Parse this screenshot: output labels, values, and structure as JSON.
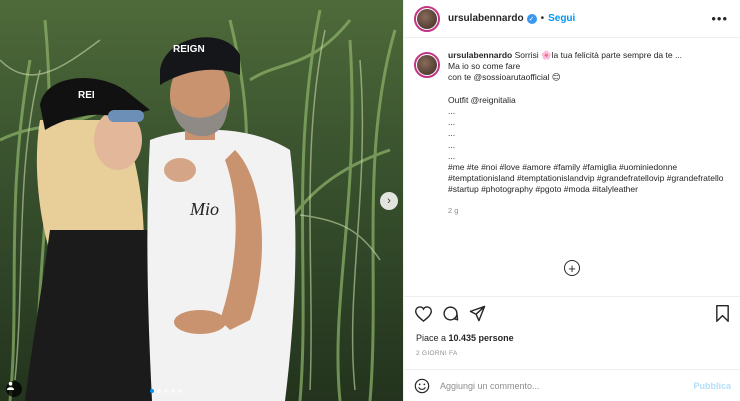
{
  "post": {
    "username": "ursulabennardo",
    "follow_label": "Segui",
    "separator": "•",
    "more_label": "•••",
    "caption_lines": [
      "Sorrisi 🌸la tua felicità parte sempre da te ...",
      "Ma io so come fare",
      "con te @sossioarutaofficial 😊",
      "",
      "Outfit @reignitalia",
      "...",
      "...",
      "...",
      "...",
      "..."
    ],
    "hashtags": "#me #te #noi #love #amore #family #famiglia #uominiedonne #temptationisland #temptationislandvip #grandefratellovip #grandefratello #startup #photography #pgoto #moda #italyleather",
    "comment_age": "2 g",
    "likes_prefix": "Piace a ",
    "likes_count": "10.435 persone",
    "date": "2 GIORNI FA",
    "comment_placeholder": "Aggiungi un commento...",
    "publish_label": "Pubblica",
    "photo_nav_next": "›",
    "carousel_count": 5,
    "carousel_active": 0
  },
  "icons": {
    "heart": "heart-icon",
    "comment": "comment-icon",
    "share": "share-icon",
    "save": "bookmark-icon",
    "emoji": "emoji-icon",
    "add": "plus-circle-icon",
    "tag": "person-tag-icon"
  },
  "colors": {
    "accent": "#0095f6",
    "verified": "#3897f0",
    "muted": "#8e8e8e",
    "publish_disabled": "#b2dffc"
  }
}
